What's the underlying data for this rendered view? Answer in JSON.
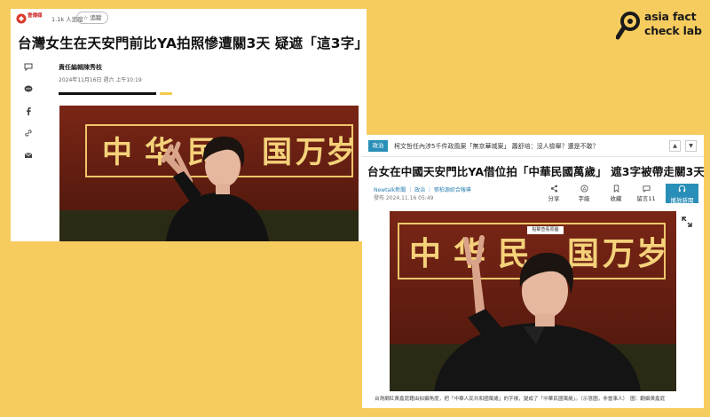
{
  "brand": {
    "line1": "asia fact",
    "line2": "check lab",
    "color": "#1a1a1a"
  },
  "shot1": {
    "site_name": "壹傳媒",
    "followers": "1.1k 人追蹤",
    "track_label": "☆ 追蹤",
    "headline": "台灣女生在天安門前比YA拍照慘遭關3天 疑遮「這3字」",
    "author": "責任編輯陳秀枝",
    "date": "2024年11月16日 週六 上午10:19",
    "accent_color": "#f2c94c",
    "sidebar_icons": [
      "comment-icon",
      "chat-icon",
      "facebook-icon",
      "link-icon",
      "mail-icon"
    ]
  },
  "shot2": {
    "category": "政治",
    "ticker": "柯文哲任內涉5千件政風案「無京華城案」 蕭舒培：沒人檢舉？還是不敢？",
    "prev": "▲",
    "next": "▼",
    "headline": "台女在中國天安門比YA借位拍「中華民國萬歲」 遮3字被帶走關3天",
    "source": "Newtalk新聞 ｜ 政治 ｜ 張柏源綜合報導",
    "pubdate": "發布 2024.11.16 05:49",
    "actions": [
      {
        "icon": "share-icon",
        "label": "分享"
      },
      {
        "icon": "font-size-icon",
        "label": "字級"
      },
      {
        "icon": "bookmark-icon",
        "label": "收藏"
      },
      {
        "icon": "comment-icon",
        "label": "留言11"
      }
    ],
    "listen_label": "播放新聞",
    "photo_tag": "點擊查看原圖",
    "caption": "台灣網紅黃鑫庭藉由拍攝角度，把「中華人民共和國萬歲」的字樣，變成了「中華民國萬歲」。（示意圖，非當事人）　圖：翻攝黃鑫庭",
    "accent_color": "#2a8fb8"
  },
  "photo": {
    "sign_chars": [
      "中",
      "华",
      "民",
      "国",
      "万",
      "岁"
    ]
  }
}
